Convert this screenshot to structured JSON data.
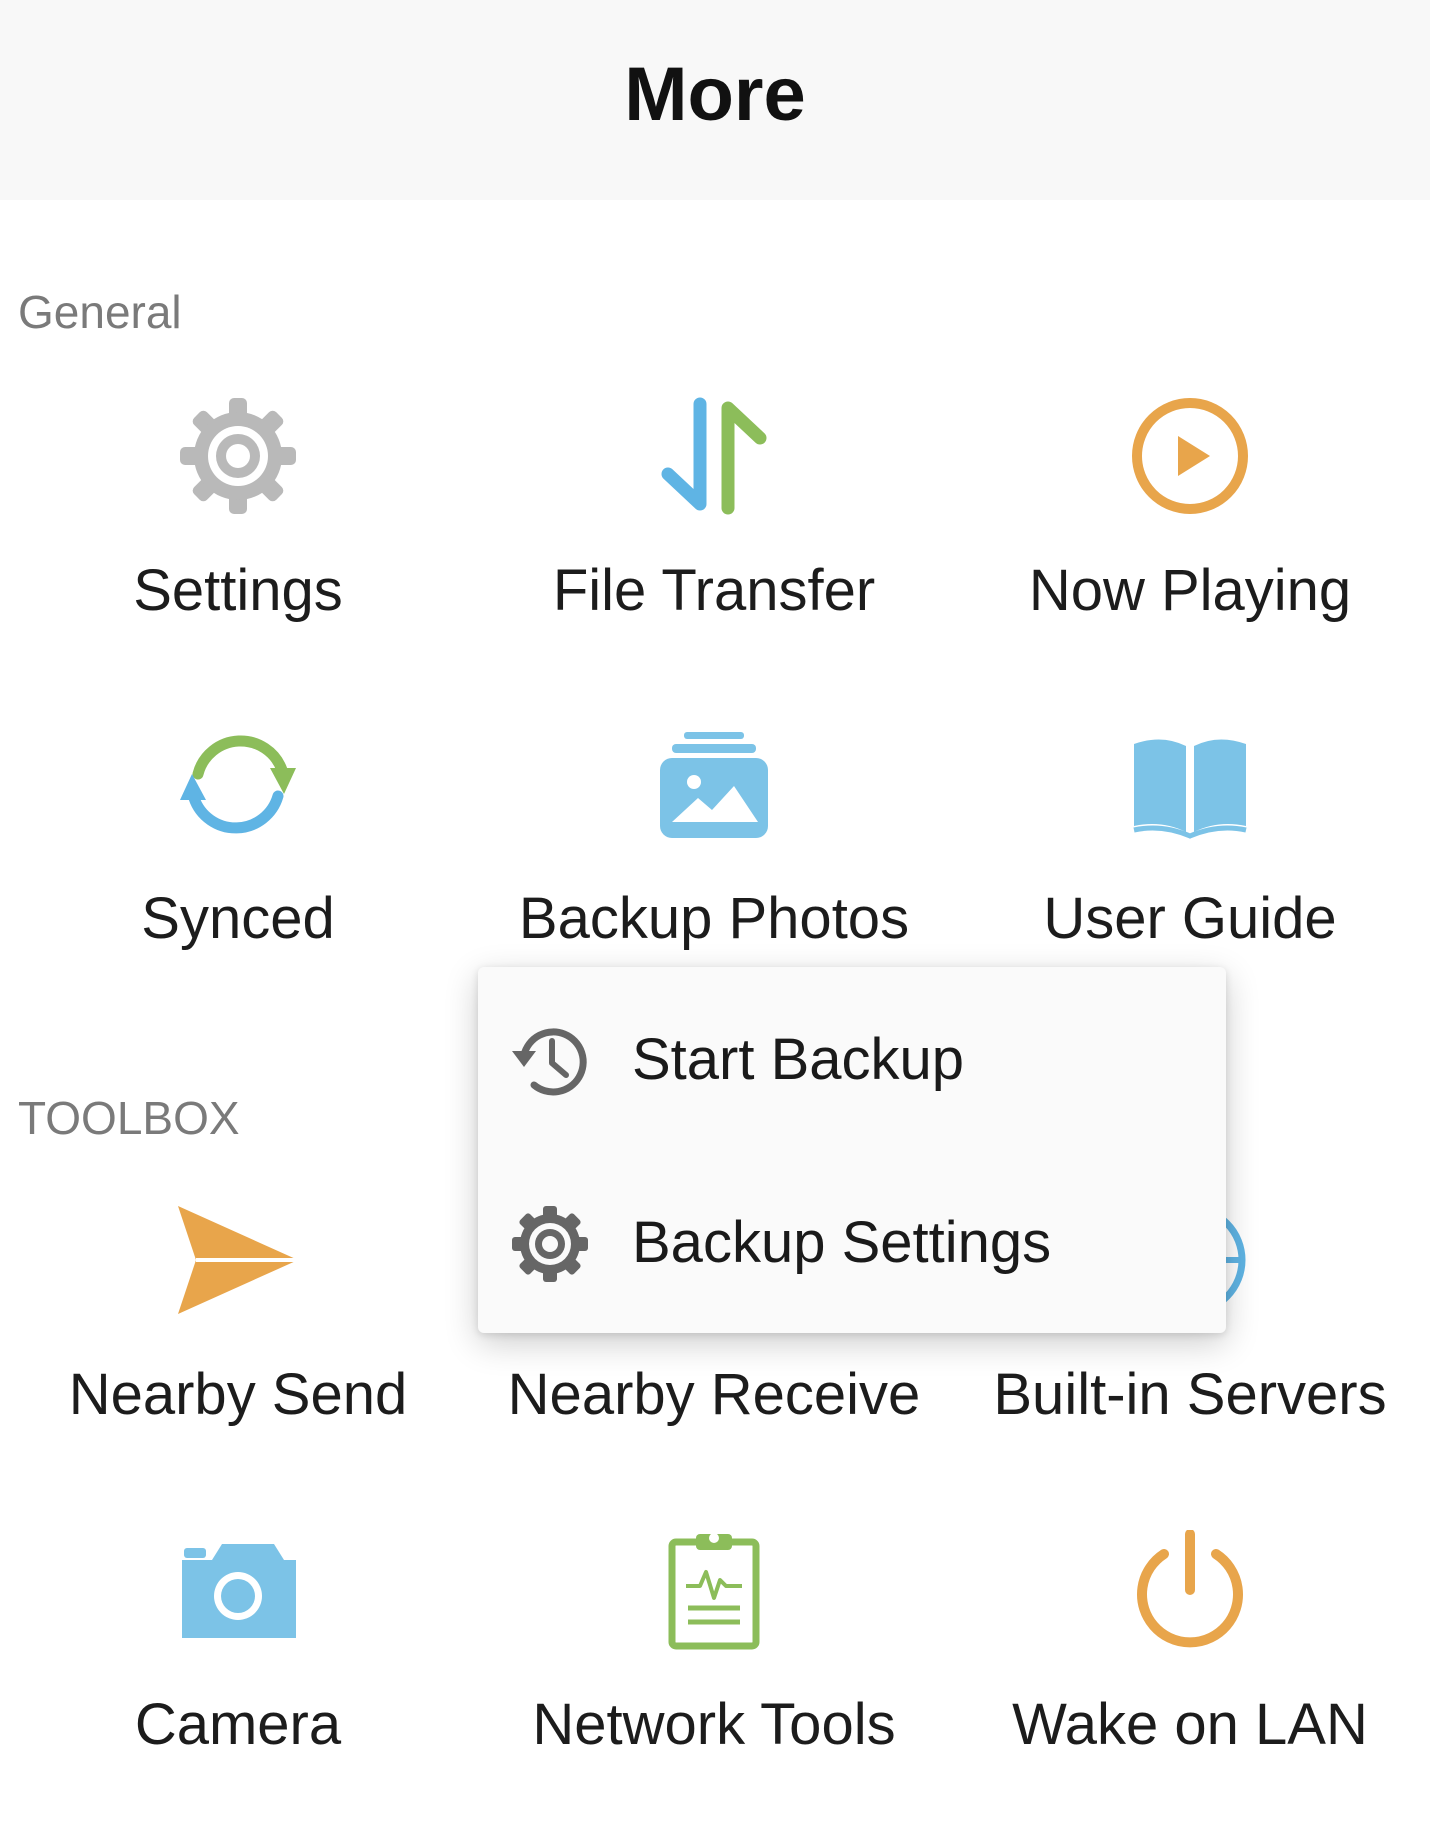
{
  "header": {
    "title": "More"
  },
  "sections": {
    "general_label": "General",
    "toolbox_label": "TOOLBOX"
  },
  "general": [
    {
      "label": "Settings",
      "icon": "gear-icon",
      "color": "#b9b9b9"
    },
    {
      "label": "File Transfer",
      "icon": "transfer-arrows-icon",
      "colors": [
        "#5fb4e4",
        "#8cbd5a"
      ]
    },
    {
      "label": "Now Playing",
      "icon": "play-circle-icon",
      "color": "#e8a54b"
    },
    {
      "label": "Synced",
      "icon": "sync-icon",
      "colors": [
        "#8cbd5a",
        "#5fb4e4"
      ]
    },
    {
      "label": "Backup Photos",
      "icon": "photo-stack-icon",
      "color": "#7cc3e7"
    },
    {
      "label": "User Guide",
      "icon": "open-book-icon",
      "color": "#7cc3e7"
    }
  ],
  "toolbox": [
    {
      "label": "Nearby Send",
      "icon": "paper-plane-icon",
      "color": "#e8a54b"
    },
    {
      "label": "Nearby Receive",
      "icon": "receive-icon"
    },
    {
      "label": "Built-in Servers",
      "icon": "globe-icon",
      "color": "#5fb4e4"
    },
    {
      "label": "Camera",
      "icon": "camera-icon",
      "color": "#7cc3e7"
    },
    {
      "label": "Network Tools",
      "icon": "clipboard-pulse-icon",
      "color": "#8cbd5a"
    },
    {
      "label": "Wake on LAN",
      "icon": "power-icon",
      "color": "#e8a54b"
    }
  ],
  "popup_menu": {
    "items": [
      {
        "label": "Start Backup",
        "icon": "history-clock-icon"
      },
      {
        "label": "Backup Settings",
        "icon": "gear-icon"
      }
    ],
    "icon_color": "#666666"
  }
}
